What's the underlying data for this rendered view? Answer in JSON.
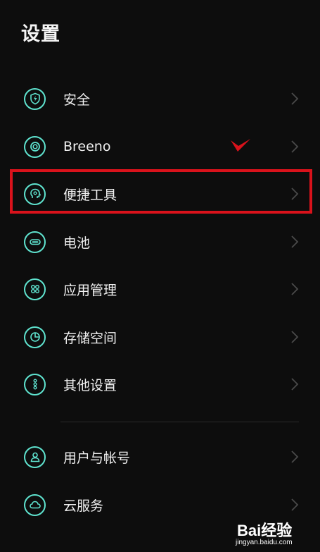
{
  "header": {
    "title": "设置"
  },
  "accent": "#5fe3cf",
  "highlight_color": "#d9121b",
  "items": [
    {
      "label": "安全",
      "icon": "shield-bolt-icon"
    },
    {
      "label": "Breeno",
      "icon": "breeno-ring-icon"
    },
    {
      "label": "便捷工具",
      "icon": "head-gear-icon"
    },
    {
      "label": "电池",
      "icon": "battery-icon"
    },
    {
      "label": "应用管理",
      "icon": "app-grid-icon"
    },
    {
      "label": "存储空间",
      "icon": "pie-chart-icon"
    },
    {
      "label": "其他设置",
      "icon": "more-dots-icon"
    },
    {
      "label": "用户与帐号",
      "icon": "user-icon"
    },
    {
      "label": "云服务",
      "icon": "cloud-icon"
    }
  ],
  "watermark": {
    "brand": "Bai经验",
    "url": "jingyan.baidu.com"
  }
}
